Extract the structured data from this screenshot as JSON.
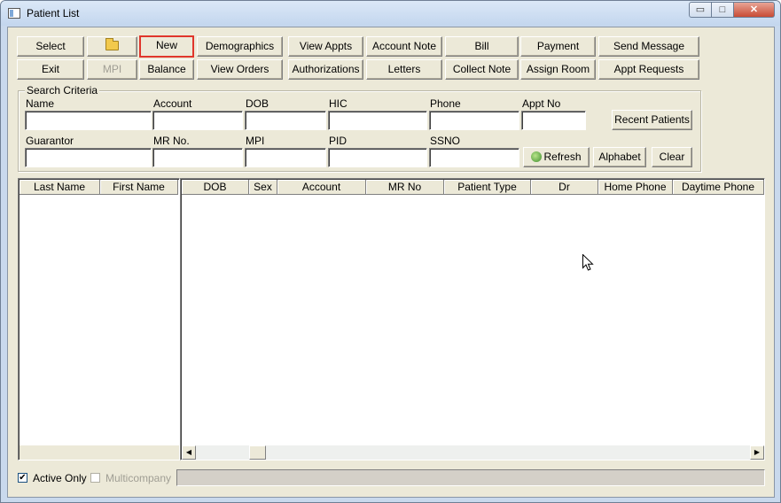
{
  "window": {
    "title": "Patient List",
    "controls": {
      "minimize": "▭",
      "maximize": "□",
      "close": "✕"
    }
  },
  "toolbar": {
    "row1": [
      "Select",
      "",
      "New",
      "Demographics",
      "View Appts",
      "Account Note",
      "Bill",
      "Payment",
      "Send Message"
    ],
    "row2": [
      "Exit",
      "MPI",
      "Balance",
      "View Orders",
      "Authorizations",
      "Letters",
      "Collect Note",
      "Assign Room",
      "Appt Requests"
    ],
    "folder_icon": "folder-icon",
    "highlighted_button": "New",
    "disabled_buttons": [
      "MPI"
    ]
  },
  "search": {
    "legend": "Search Criteria",
    "labels": {
      "name": "Name",
      "account": "Account",
      "dob": "DOB",
      "hic": "HIC",
      "phone": "Phone",
      "appt_no": "Appt No",
      "guarantor": "Guarantor",
      "mr_no": "MR No.",
      "mpi": "MPI",
      "pid": "PID",
      "ssno": "SSNO"
    },
    "values": {
      "name": "",
      "account": "",
      "dob": "",
      "hic": "",
      "phone": "",
      "appt_no": "",
      "guarantor": "",
      "mr_no": "",
      "mpi": "",
      "pid": "",
      "ssno": ""
    },
    "buttons": {
      "recent": "Recent Patients",
      "refresh": "Refresh",
      "alphabet": "Alphabet",
      "clear": "Clear"
    }
  },
  "list": {
    "left_columns": [
      "Last Name",
      "First Name"
    ],
    "right_columns": [
      "DOB",
      "Sex",
      "Account",
      "MR No",
      "Patient Type",
      "Dr",
      "Home Phone",
      "Daytime Phone"
    ],
    "rows": []
  },
  "footer": {
    "active_only": {
      "label": "Active Only",
      "checked": true
    },
    "multicompany": {
      "label": "Multicompany",
      "checked": false,
      "disabled": true
    }
  }
}
